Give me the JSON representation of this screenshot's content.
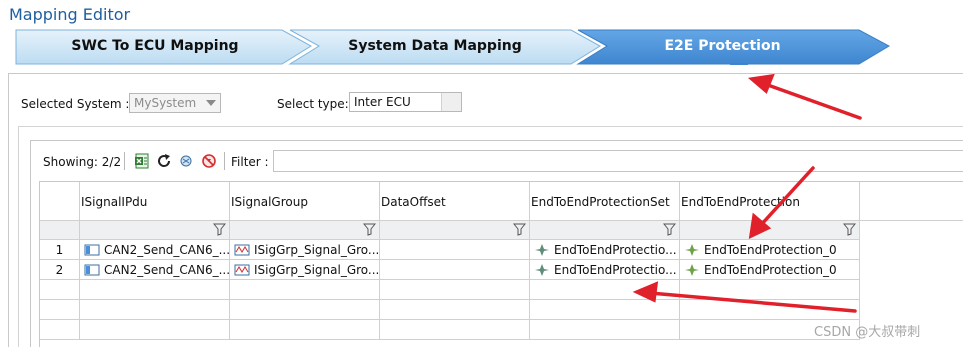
{
  "app": {
    "title": "Mapping Editor"
  },
  "breadcrumbs": [
    {
      "label": "SWC To ECU Mapping",
      "active": false
    },
    {
      "label": "System Data Mapping",
      "active": false
    },
    {
      "label": "E2E Protection",
      "active": true
    }
  ],
  "controls": {
    "selected_system_label": "Selected System :",
    "selected_system_value": "MySystem",
    "select_type_label": "Select type:",
    "select_type_value": "Inter ECU"
  },
  "toolbar": {
    "showing": "Showing: 2/2",
    "filter_label": "Filter :",
    "filter_value": "",
    "icons": [
      "excel-export-icon",
      "refresh-icon",
      "settings-icon",
      "clear-filter-icon"
    ]
  },
  "table": {
    "columns": [
      "ISignalIPdu",
      "ISignalGroup",
      "DataOffset",
      "EndToEndProtectionSet",
      "EndToEndProtection"
    ],
    "rows": [
      {
        "num": "1",
        "pdu": "CAN2_Send_CAN6_...",
        "group": "ISigGrp_Signal_Gro...",
        "offset": "",
        "set": "EndToEndProtectio...",
        "prot": "EndToEndProtection_0"
      },
      {
        "num": "2",
        "pdu": "CAN2_Send_CAN6_...",
        "group": "ISigGrp_Signal_Gro...",
        "offset": "",
        "set": "EndToEndProtectio...",
        "prot": "EndToEndProtection_0"
      }
    ]
  },
  "watermark": "CSDN @大叔带刺",
  "colors": {
    "title": "#1f5fa0",
    "crumb_inactive": "#cfe6f7",
    "crumb_active": "#4a90d9",
    "annotation_arrow": "#e0202a"
  }
}
